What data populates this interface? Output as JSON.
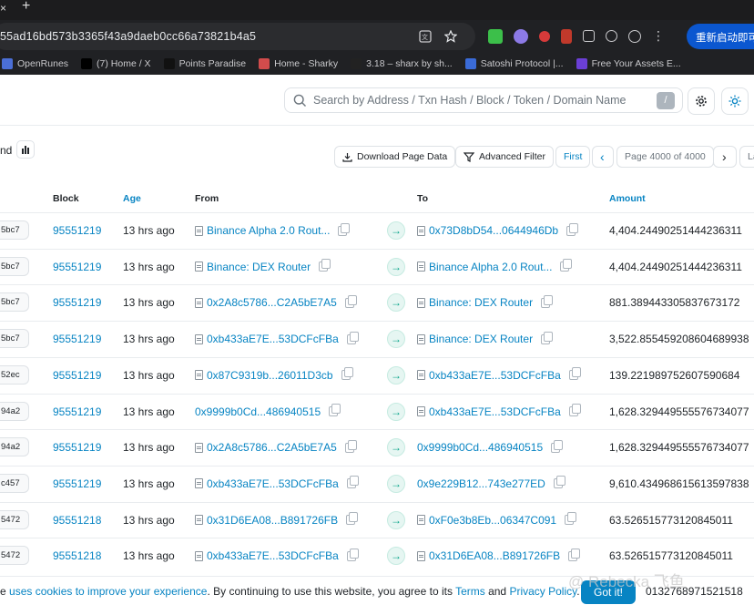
{
  "browser": {
    "address": "55ad16bd573b3365f43a9daeb0cc66a73821b4a5",
    "relaunch_label": "重新启动即可",
    "close_glyph": "×",
    "new_tab_glyph": "+"
  },
  "bookmarks": [
    {
      "label": "OpenRunes",
      "color": "#4b6fd6"
    },
    {
      "label": "(7) Home / X",
      "color": "#000000"
    },
    {
      "label": "Points Paradise",
      "color": "#111111"
    },
    {
      "label": "Home - Sharky",
      "color": "#d24c4c"
    },
    {
      "label": "3.18 – sharx by sh...",
      "color": "#222222"
    },
    {
      "label": "Satoshi Protocol |...",
      "color": "#3a6bd8"
    },
    {
      "label": "Free Your Assets E...",
      "color": "#6b3fd6"
    }
  ],
  "header": {
    "search_placeholder": "Search by Address / Txn Hash / Block / Token / Domain Name",
    "search_shortcut": "/"
  },
  "toolbar": {
    "title_fragment": "nd",
    "download_label": "Download Page Data",
    "filter_label": "Advanced Filter",
    "first_label": "First",
    "prev_glyph": "‹",
    "page_label": "Page 4000 of 4000",
    "next_glyph": "›",
    "last_fragment": "La"
  },
  "table": {
    "headers": {
      "block": "Block",
      "age": "Age",
      "from": "From",
      "to": "To",
      "amount": "Amount"
    },
    "rows": [
      {
        "hash": "5bc7",
        "block": "95551219",
        "age": "13 hrs ago",
        "from": "Binance Alpha 2.0 Rout...",
        "to": "0x73D8bD54...0644946Db",
        "amount": "4,404.24490251444236311"
      },
      {
        "hash": "5bc7",
        "block": "95551219",
        "age": "13 hrs ago",
        "from": "Binance: DEX Router",
        "to": "Binance Alpha 2.0 Rout...",
        "amount": "4,404.24490251444236311"
      },
      {
        "hash": "5bc7",
        "block": "95551219",
        "age": "13 hrs ago",
        "from": "0x2A8c5786...C2A5bE7A5",
        "to": "Binance: DEX Router",
        "amount": "881.389443305837673172"
      },
      {
        "hash": "5bc7",
        "block": "95551219",
        "age": "13 hrs ago",
        "from": "0xb433aE7E...53DCFcFBa",
        "to": "Binance: DEX Router",
        "amount": "3,522.855459208604689938"
      },
      {
        "hash": "52ec",
        "block": "95551219",
        "age": "13 hrs ago",
        "from": "0x87C9319b...26011D3cb",
        "to": "0xb433aE7E...53DCFcFBa",
        "amount": "139.221989752607590684"
      },
      {
        "hash": "94a2",
        "block": "95551219",
        "age": "13 hrs ago",
        "from": "0x9999b0Cd...486940515",
        "to": "0xb433aE7E...53DCFcFBa",
        "amount": "1,628.329449555576734077",
        "from_plain": true
      },
      {
        "hash": "94a2",
        "block": "95551219",
        "age": "13 hrs ago",
        "from": "0x2A8c5786...C2A5bE7A5",
        "to": "0x9999b0Cd...486940515",
        "amount": "1,628.329449555576734077",
        "to_plain": true
      },
      {
        "hash": "c457",
        "block": "95551219",
        "age": "13 hrs ago",
        "from": "0xb433aE7E...53DCFcFBa",
        "to": "0x9e229B12...743e277ED",
        "amount": "9,610.434968615613597838",
        "to_plain": true
      },
      {
        "hash": "5472",
        "block": "95551218",
        "age": "13 hrs ago",
        "from": "0x31D6EA08...B891726FB",
        "to": "0xF0e3b8Eb...06347C091",
        "amount": "63.526515773120845011"
      },
      {
        "hash": "5472",
        "block": "95551218",
        "age": "13 hrs ago",
        "from": "0xb433aE7E...53DCFcFBa",
        "to": "0x31D6EA08...B891726FB",
        "amount": "63.526515773120845011"
      }
    ]
  },
  "cookie": {
    "prefix": "e ",
    "link1": "uses cookies to improve your experience",
    "middle": ". By continuing to use this website, you agree to its ",
    "terms": "Terms",
    "and": " and ",
    "privacy": "Privacy Policy",
    "suffix": ".",
    "got_it": "Got it!",
    "tail_amount": "0132768971521518"
  },
  "watermark": "@ Rebecka 飞鱼",
  "arrow_glyph": "→"
}
